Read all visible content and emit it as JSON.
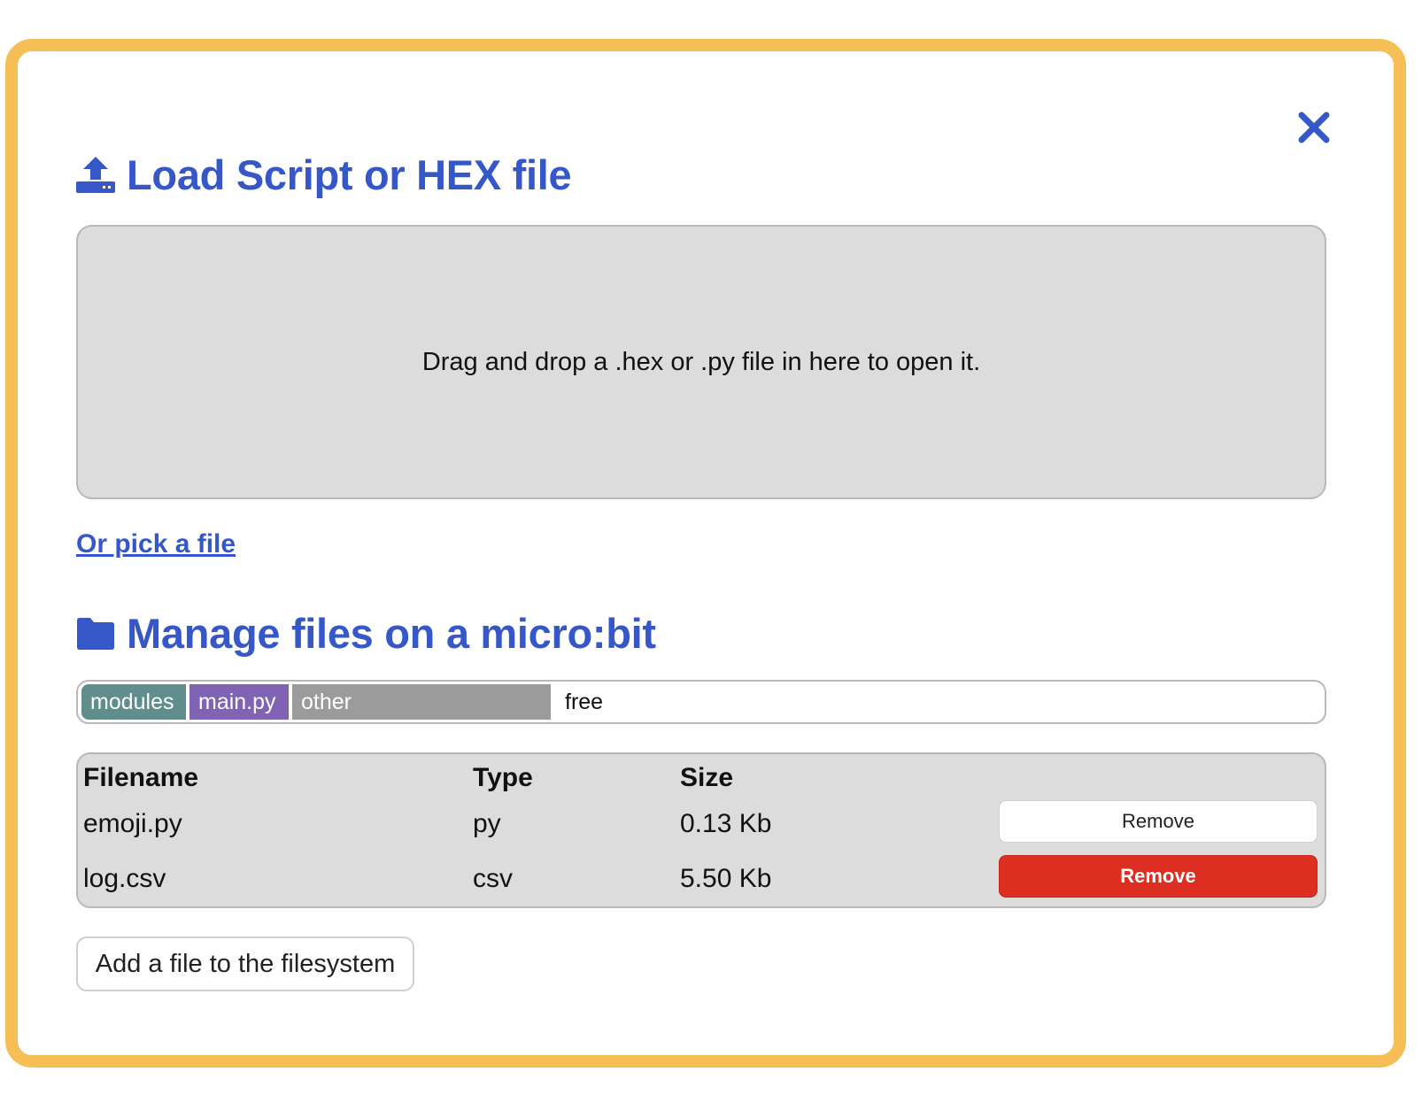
{
  "colors": {
    "accent": "#3557c8",
    "frame": "#f5bf55",
    "modules_segment": "#5f8e8c",
    "main_segment": "#8163b4",
    "other_segment": "#9b9b9b",
    "danger": "#dd2e22"
  },
  "icons": {
    "close": "close-icon",
    "upload": "upload-icon",
    "folder": "folder-icon"
  },
  "load": {
    "title": "Load Script or HEX file",
    "dropzone_text": "Drag and drop a .hex or .py file in here to open it.",
    "pick_link": "Or pick a file"
  },
  "manage": {
    "title": "Manage files on a micro:bit",
    "storage": {
      "modules": "modules",
      "main": "main.py",
      "other": "other",
      "free": "free"
    },
    "table": {
      "headers": {
        "filename": "Filename",
        "type": "Type",
        "size": "Size"
      },
      "rows": [
        {
          "filename": "emoji.py",
          "type": "py",
          "size": "0.13 Kb",
          "action": "Remove"
        },
        {
          "filename": "log.csv",
          "type": "csv",
          "size": "5.50 Kb",
          "action": "Remove"
        }
      ]
    },
    "add_button": "Add a file to the filesystem"
  }
}
